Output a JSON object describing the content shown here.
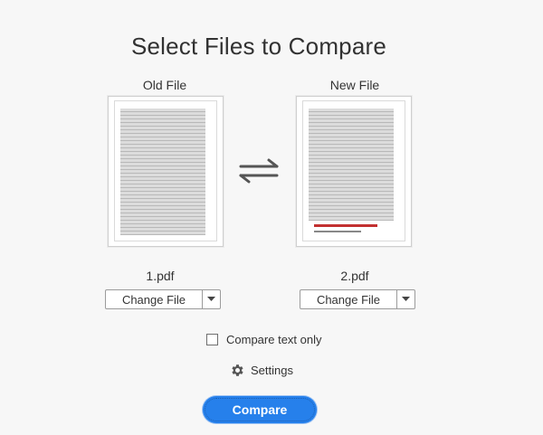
{
  "title": "Select Files to Compare",
  "old_file": {
    "label": "Old File",
    "filename": "1.pdf",
    "change_label": "Change File"
  },
  "new_file": {
    "label": "New File",
    "filename": "2.pdf",
    "change_label": "Change File"
  },
  "options": {
    "compare_text_only_label": "Compare text only",
    "compare_text_only_checked": false,
    "settings_label": "Settings"
  },
  "compare_label": "Compare",
  "colors": {
    "accent": "#2680eb",
    "background": "#f7f7f7"
  },
  "icons": [
    "swap-arrows-icon",
    "chevron-down-icon",
    "gear-icon"
  ]
}
